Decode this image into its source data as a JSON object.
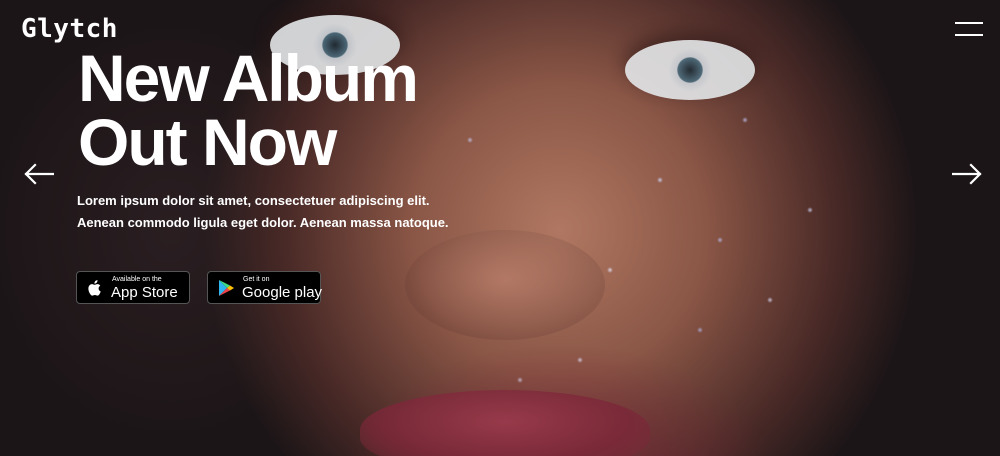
{
  "brand": {
    "logo_text": "Glytch"
  },
  "hero": {
    "headline_line1": "New Album",
    "headline_line2": "Out Now",
    "description_line1": "Lorem ipsum dolor sit amet, consectetuer adipiscing elit.",
    "description_line2": "Aenean commodo ligula eget dolor. Aenean massa natoque."
  },
  "stores": {
    "apple": {
      "small_label": "Available on the",
      "big_label": "App Store",
      "icon": "apple-icon"
    },
    "google": {
      "small_label": "Get it on",
      "big_label": "Google play",
      "icon": "google-play-icon"
    }
  },
  "nav": {
    "menu_icon": "hamburger-icon",
    "prev_icon": "arrow-left-icon",
    "next_icon": "arrow-right-icon"
  },
  "colors": {
    "text": "#ffffff",
    "button_bg": "#000000"
  }
}
